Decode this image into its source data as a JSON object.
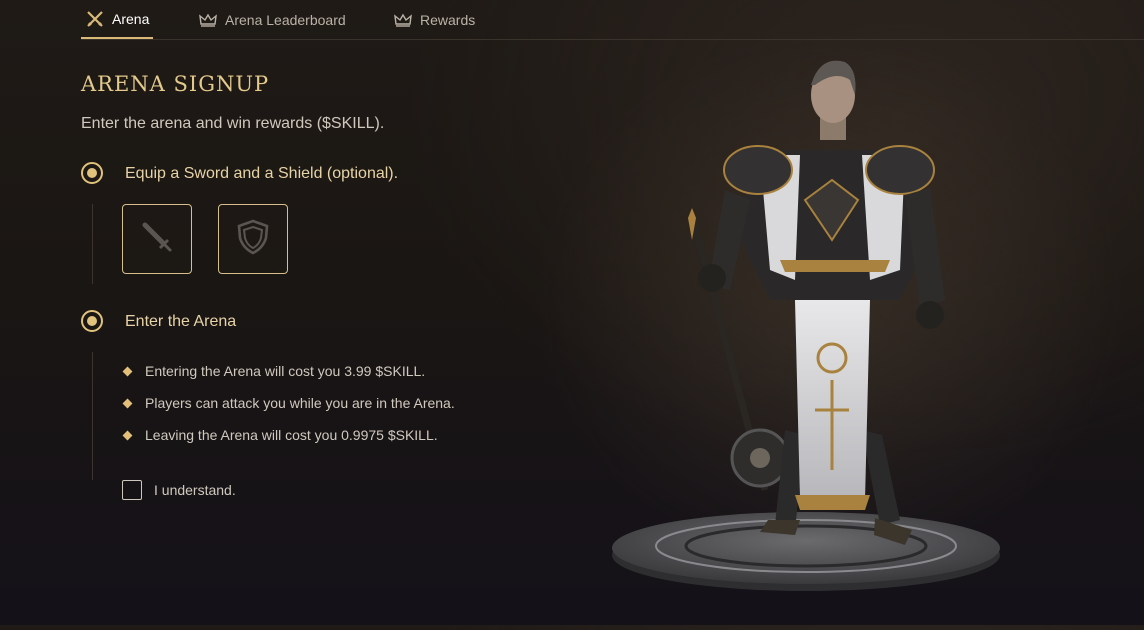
{
  "tabs": [
    {
      "label": "Arena",
      "icon": "crossed-swords-icon",
      "active": true
    },
    {
      "label": "Arena Leaderboard",
      "icon": "crown-icon",
      "active": false
    },
    {
      "label": "Rewards",
      "icon": "crown-icon",
      "active": false
    }
  ],
  "signup": {
    "title": "ARENA SIGNUP",
    "subtitle": "Enter the arena and win rewards ($SKILL).",
    "step1": {
      "label": "Equip a Sword and a Shield (optional).",
      "slots": [
        "sword-icon",
        "shield-icon"
      ]
    },
    "step2": {
      "label": "Enter the Arena"
    },
    "bullets": [
      "Entering the Arena will cost you 3.99 $SKILL.",
      "Players can attack you while you are in the Arena.",
      "Leaving the Arena will cost you 0.9975 $SKILL."
    ],
    "acknowledge": {
      "label": "I understand.",
      "checked": false
    }
  },
  "colors": {
    "accent": "#e0c27c",
    "background": "#1c1714"
  }
}
